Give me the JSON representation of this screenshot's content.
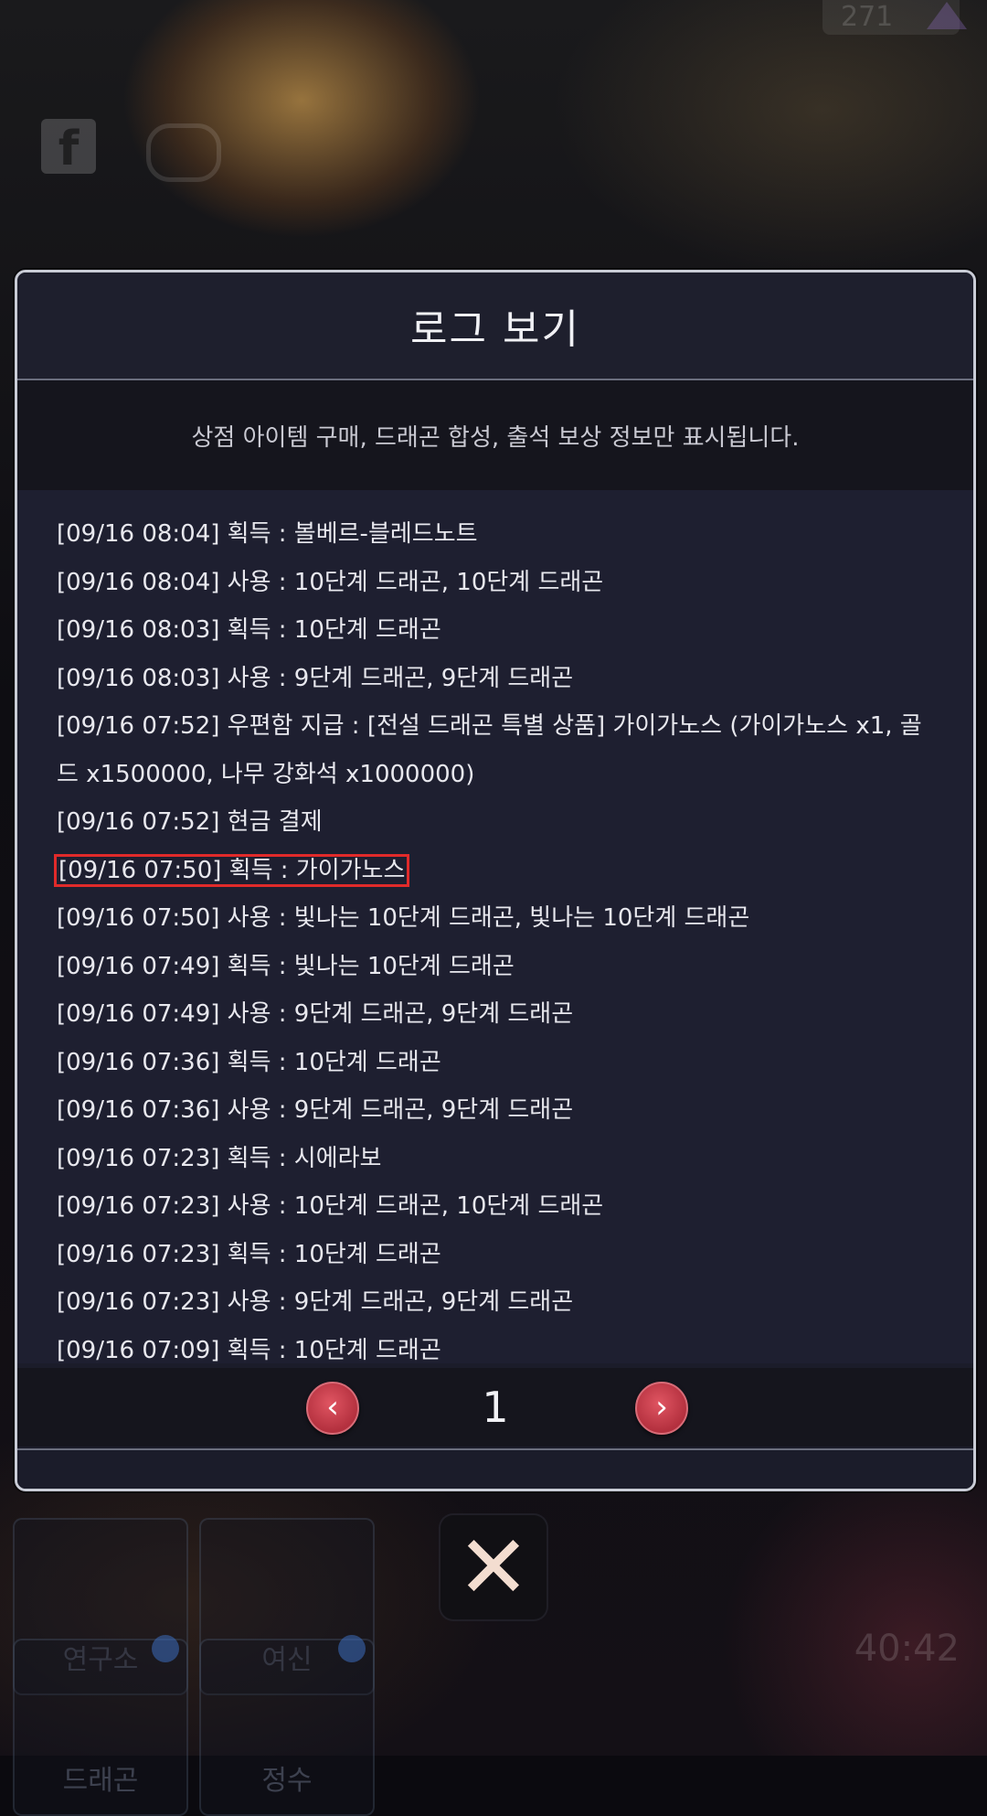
{
  "background": {
    "top_counter": "271",
    "tiles": [
      {
        "label": "연구소"
      },
      {
        "label": "여신"
      },
      {
        "label": "드래곤"
      },
      {
        "label": "정수"
      }
    ],
    "timer": "40:42"
  },
  "modal": {
    "title": "로그 보기",
    "notice": "상점 아이템 구매, 드래곤 합성, 출석 보상 정보만 표시됩니다.",
    "log_entries": [
      "[09/16 08:04] 획득 : 볼베르-블레드노트",
      "[09/16 08:04] 사용 : 10단계 드래곤, 10단계 드래곤",
      "[09/16 08:03] 획득 : 10단계 드래곤",
      "[09/16 08:03] 사용 : 9단계 드래곤, 9단계 드래곤",
      "[09/16 07:52] 우편함 지급 : [전설 드래곤 특별 상품] 가이가노스 (가이가노스 x1, 골드 x1500000, 나무 강화석 x1000000)",
      "[09/16 07:52] 현금 결제",
      "[09/16 07:50] 획득 : 가이가노스",
      "[09/16 07:50] 사용 : 빛나는 10단계 드래곤, 빛나는 10단계 드래곤",
      "[09/16 07:49] 획득 : 빛나는 10단계 드래곤",
      "[09/16 07:49] 사용 : 9단계 드래곤, 9단계 드래곤",
      "[09/16 07:36] 획득 : 10단계 드래곤",
      "[09/16 07:36] 사용 : 9단계 드래곤, 9단계 드래곤",
      "[09/16 07:23] 획득 : 시에라보",
      "[09/16 07:23] 사용 : 10단계 드래곤, 10단계 드래곤",
      "[09/16 07:23] 획득 : 10단계 드래곤",
      "[09/16 07:23] 사용 : 9단계 드래곤, 9단계 드래곤",
      "[09/16 07:09] 획득 : 10단계 드래곤"
    ],
    "highlighted_index": 6,
    "highlight_color": "#e12a2a",
    "pager": {
      "prev_icon": "chevron-left-icon",
      "page": "1",
      "next_icon": "chevron-right-icon",
      "button_color": "#c23a48"
    }
  },
  "close_button": {
    "icon": "close-icon",
    "glyph": "✕"
  }
}
